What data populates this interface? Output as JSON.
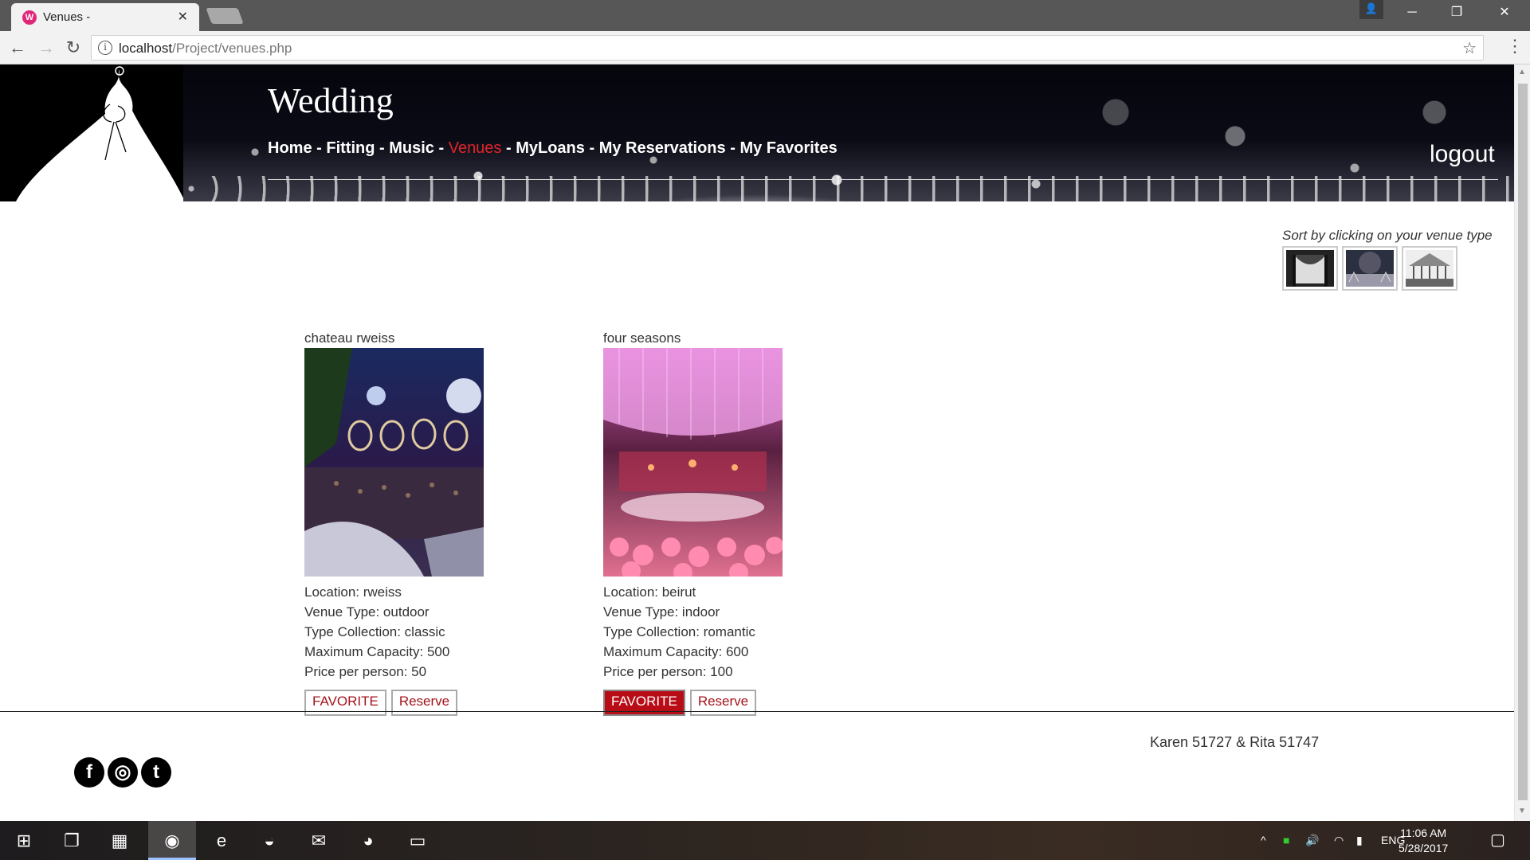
{
  "browser": {
    "tab_title": "Venues -",
    "tab_favicon": "W",
    "url_host": "localhost",
    "url_path": "/Project/venues.php"
  },
  "site": {
    "title": "Wedding",
    "nav": [
      {
        "label": "Home",
        "active": false
      },
      {
        "label": "Fitting",
        "active": false
      },
      {
        "label": "Music",
        "active": false
      },
      {
        "label": "Venues",
        "active": true
      },
      {
        "label": "MyLoans",
        "active": false
      },
      {
        "label": "My Reservations",
        "active": false
      },
      {
        "label": "My Favorites",
        "active": false
      }
    ],
    "nav_separator": " - ",
    "logout_label": "logout"
  },
  "sort": {
    "label": "Sort by clicking on your venue type",
    "thumbs": [
      "venue-type-hall-icon",
      "venue-type-garden-icon",
      "venue-type-glasshouse-icon"
    ]
  },
  "venues": [
    {
      "name": "chateau rweiss",
      "location": "Location: rweiss",
      "type": "Venue Type: outdoor",
      "collection": "Type Collection: classic",
      "capacity": "Maximum Capacity: 500",
      "price": "Price per person: 50",
      "favorite_label": "FAVORITE",
      "favorite_on": false,
      "reserve_label": "Reserve"
    },
    {
      "name": "four seasons",
      "location": "Location: beirut",
      "type": "Venue Type: indoor",
      "collection": "Type Collection: romantic",
      "capacity": "Maximum Capacity: 600",
      "price": "Price per person: 100",
      "favorite_label": "FAVORITE",
      "favorite_on": true,
      "reserve_label": "Reserve"
    }
  ],
  "footer": {
    "credits": "Karen 51727 & Rita 51747",
    "social": [
      {
        "name": "facebook-icon",
        "glyph": "f"
      },
      {
        "name": "instagram-icon",
        "glyph": "◎"
      },
      {
        "name": "twitter-icon",
        "glyph": "t"
      }
    ]
  },
  "taskbar": {
    "language": "ENG",
    "time": "11:06 AM",
    "date": "5/28/2017"
  },
  "colors": {
    "accent_red": "#b80d17",
    "nav_active": "#e0242b"
  }
}
